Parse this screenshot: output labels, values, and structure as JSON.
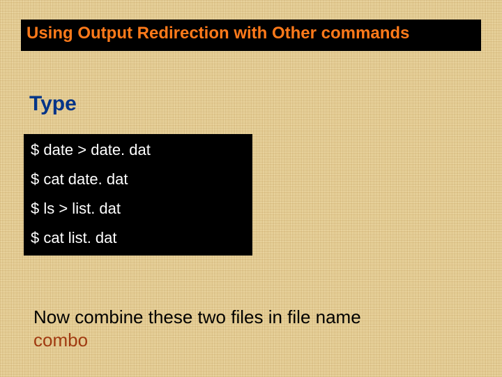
{
  "title": "Using Output Redirection with Other commands",
  "type_label": "Type",
  "commands": [
    "$ date > date. dat",
    "$ cat date. dat",
    "$ ls > list. dat",
    "$ cat list. dat"
  ],
  "instruction_lead": "Now combine these two files in file name",
  "instruction_tail": "combo",
  "colors": {
    "title_accent": "#ff7a1a",
    "heading": "#003488",
    "instruction_tail": "#a03a10"
  }
}
